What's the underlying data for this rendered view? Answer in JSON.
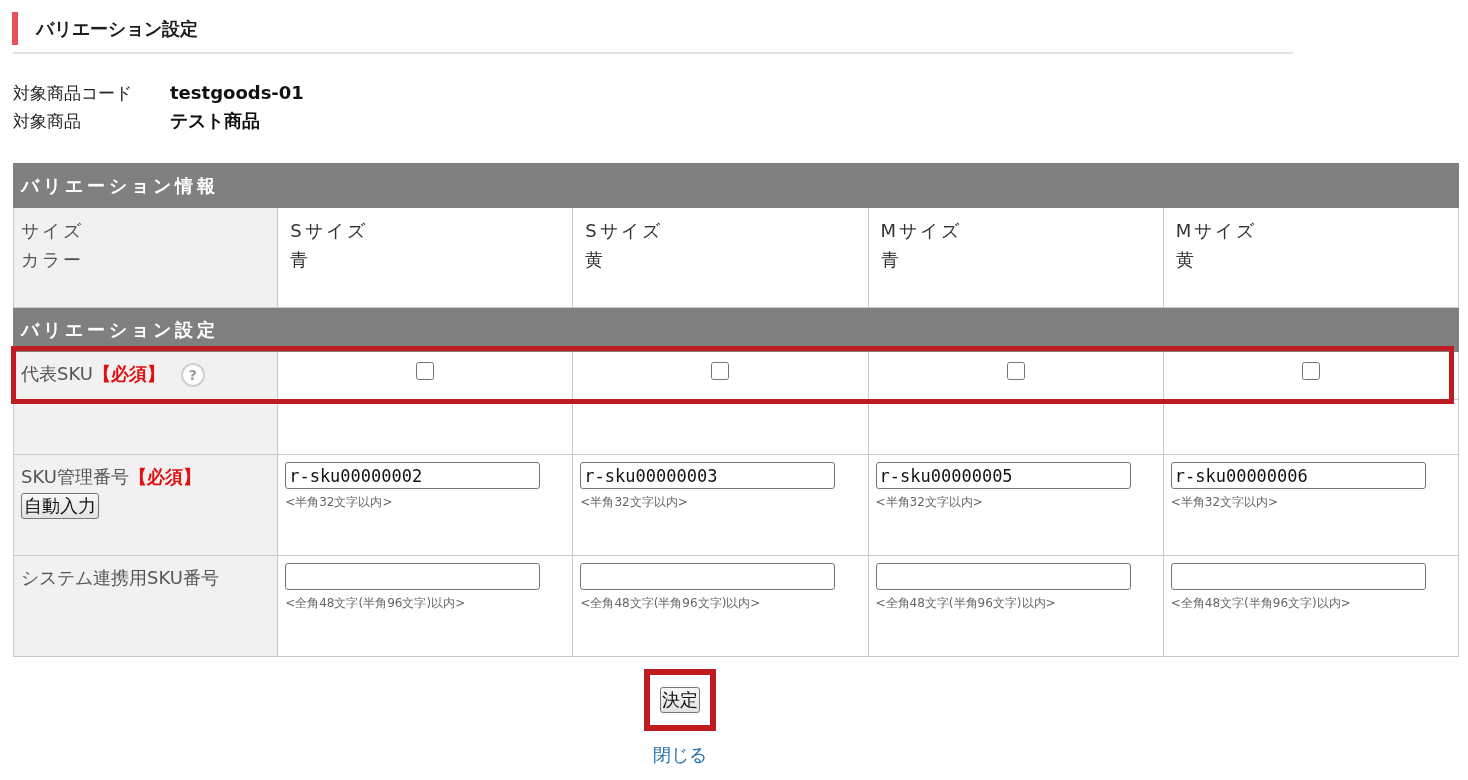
{
  "page_title": "バリエーション設定",
  "product_info": [
    {
      "label": "対象商品コード",
      "value": "testgoods-01"
    },
    {
      "label": "対象商品",
      "value": "テスト商品"
    }
  ],
  "table": {
    "rows": [
      {
        "kind": "section",
        "title": "バリエーション情報"
      },
      {
        "kind": "attributes",
        "labels": [
          "サイズ",
          "カラー"
        ],
        "cells": [
          [
            "Sサイズ",
            "青"
          ],
          [
            "Sサイズ",
            "黄"
          ],
          [
            "Mサイズ",
            "青"
          ],
          [
            "Mサイズ",
            "黄"
          ]
        ]
      },
      {
        "kind": "section",
        "title": "バリエーション設定"
      },
      {
        "kind": "checkbox",
        "label": "代表SKU",
        "required": "【必須】",
        "help": "?",
        "highlighted": true,
        "cells": [
          {
            "checked": false
          },
          {
            "checked": false
          },
          {
            "checked": false
          },
          {
            "checked": false
          }
        ]
      },
      {
        "kind": "blank"
      },
      {
        "kind": "text_input",
        "label": "SKU管理番号",
        "required": "【必須】",
        "button": "自動入力",
        "cells": [
          {
            "value": "r-sku00000002",
            "hint": "<半角32文字以内>"
          },
          {
            "value": "r-sku00000003",
            "hint": "<半角32文字以内>"
          },
          {
            "value": "r-sku00000005",
            "hint": "<半角32文字以内>"
          },
          {
            "value": "r-sku00000006",
            "hint": "<半角32文字以内>"
          }
        ]
      },
      {
        "kind": "text_input",
        "label": "システム連携用SKU番号",
        "cells": [
          {
            "hint": "<全角48文字(半角96文字)以内>"
          },
          {
            "hint": "<全角48文字(半角96文字)以内>"
          },
          {
            "hint": "<全角48文字(半角96文字)以内>"
          },
          {
            "hint": "<全角48文字(半角96文字)以内>"
          }
        ]
      }
    ]
  },
  "submit_button": {
    "label": "決定",
    "highlighted": true
  },
  "close_link": "閉じる"
}
